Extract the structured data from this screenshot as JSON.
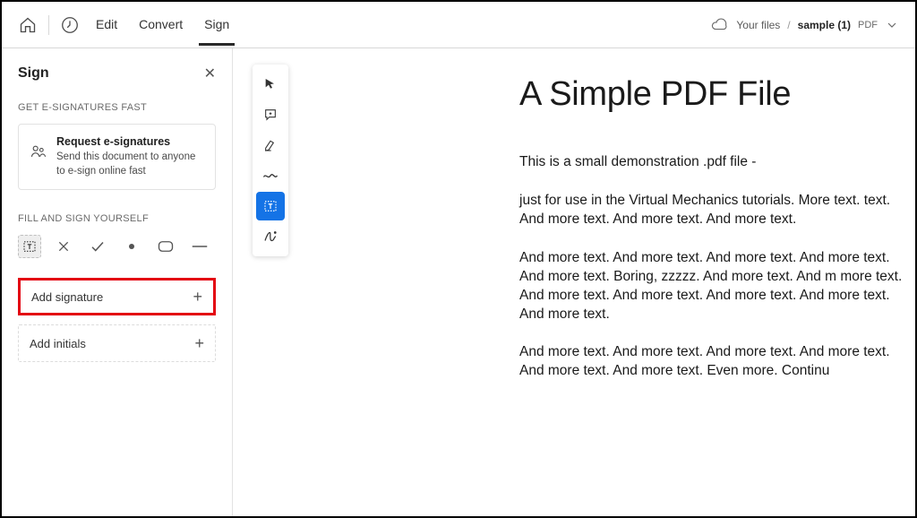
{
  "topbar": {
    "tabs": {
      "edit": "Edit",
      "convert": "Convert",
      "sign": "Sign"
    }
  },
  "breadcrumb": {
    "root": "Your files",
    "file": "sample (1)",
    "type": "PDF"
  },
  "sidebar": {
    "title": "Sign",
    "section1": "GET E-SIGNATURES FAST",
    "request": {
      "title": "Request e-signatures",
      "desc": "Send this document to anyone to e-sign online fast"
    },
    "section2": "FILL AND SIGN YOURSELF",
    "add_signature": "Add signature",
    "add_initials": "Add initials"
  },
  "doc": {
    "title": "A Simple PDF File",
    "p1": "This is a small demonstration .pdf file -",
    "p2": "just for use in the Virtual Mechanics tutorials. More text. text. And more text. And more text. And more text.",
    "p3": "And more text. And more text. And more text. And more text. And more text. Boring, zzzzz. And more text. And m more text. And more text. And more text. And more text. And more text. And more text.",
    "p4": "And more text. And more text. And more text. And more text. And more text. And more text. Even more. Continu"
  }
}
